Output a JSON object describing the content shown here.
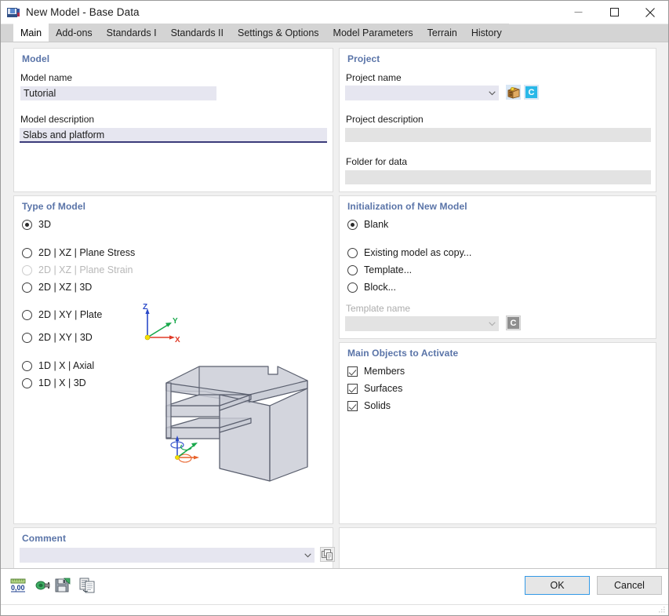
{
  "window": {
    "title": "New Model - Base Data",
    "app_icon": "new-model-icon",
    "minimize_label": "—",
    "maximize_label": "□",
    "close_label": "✕"
  },
  "tabs": [
    {
      "label": "Main",
      "active": true
    },
    {
      "label": "Add-ons",
      "active": false
    },
    {
      "label": "Standards I",
      "active": false
    },
    {
      "label": "Standards II",
      "active": false
    },
    {
      "label": "Settings & Options",
      "active": false
    },
    {
      "label": "Model Parameters",
      "active": false
    },
    {
      "label": "Terrain",
      "active": false
    },
    {
      "label": "History",
      "active": false
    }
  ],
  "model_panel": {
    "title": "Model",
    "name_label": "Model name",
    "name_value": "Tutorial",
    "description_label": "Model description",
    "description_value": "Slabs and platform"
  },
  "project_panel": {
    "title": "Project",
    "name_label": "Project name",
    "name_value": "",
    "description_label": "Project description",
    "description_value": "",
    "folder_label": "Folder for data",
    "folder_value": "",
    "cabinet_icon": "project-cabinet-icon",
    "badge_icon": "cloud-c-icon",
    "badge_text": "C"
  },
  "type_panel": {
    "title": "Type of Model",
    "options": [
      {
        "label": "3D",
        "selected": true,
        "disabled": false
      },
      {
        "label": "2D | XZ | Plane Stress",
        "selected": false,
        "disabled": false
      },
      {
        "label": "2D | XZ | Plane Strain",
        "selected": false,
        "disabled": true
      },
      {
        "label": "2D | XZ | 3D",
        "selected": false,
        "disabled": false
      },
      {
        "label": "2D | XY | Plate",
        "selected": false,
        "disabled": false
      },
      {
        "label": "2D | XY | 3D",
        "selected": false,
        "disabled": false
      },
      {
        "label": "1D | X | Axial",
        "selected": false,
        "disabled": false
      },
      {
        "label": "1D | X | 3D",
        "selected": false,
        "disabled": false
      }
    ],
    "axes": {
      "x": "X",
      "y": "Y",
      "z": "Z"
    },
    "preview_name": "model-preview-3d"
  },
  "init_panel": {
    "title": "Initialization of New Model",
    "options": [
      {
        "label": "Blank",
        "selected": true
      },
      {
        "label": "Existing model as copy...",
        "selected": false
      },
      {
        "label": "Template...",
        "selected": false
      },
      {
        "label": "Block...",
        "selected": false
      }
    ],
    "template_label": "Template name",
    "template_value": "",
    "template_badge_text": "C"
  },
  "objects_panel": {
    "title": "Main Objects to Activate",
    "items": [
      {
        "label": "Members",
        "checked": true
      },
      {
        "label": "Surfaces",
        "checked": true
      },
      {
        "label": "Solids",
        "checked": true
      }
    ]
  },
  "comment_panel": {
    "title": "Comment",
    "value": "",
    "picker_icon": "comment-list-icon"
  },
  "footer": {
    "tools": [
      {
        "name": "units-icon",
        "label": "0,00"
      },
      {
        "name": "plug-icon",
        "label": ""
      },
      {
        "name": "save-icon",
        "label": ""
      },
      {
        "name": "document-copy-icon",
        "label": ""
      }
    ],
    "ok_label": "OK",
    "cancel_label": "Cancel"
  },
  "colors": {
    "accent_heading": "#5a74a8",
    "field_bg": "#e6e6f0",
    "field_disabled_bg": "#e3e3e3",
    "focus_border": "#3c3c7a",
    "default_button_border": "#3399e6",
    "axis_x": "#e03b28",
    "axis_y": "#17a84a",
    "axis_z": "#2a49c8",
    "origin": "#f5e000",
    "surface_fill": "#c9ccd6",
    "surface_stroke": "#5a5f6e"
  }
}
